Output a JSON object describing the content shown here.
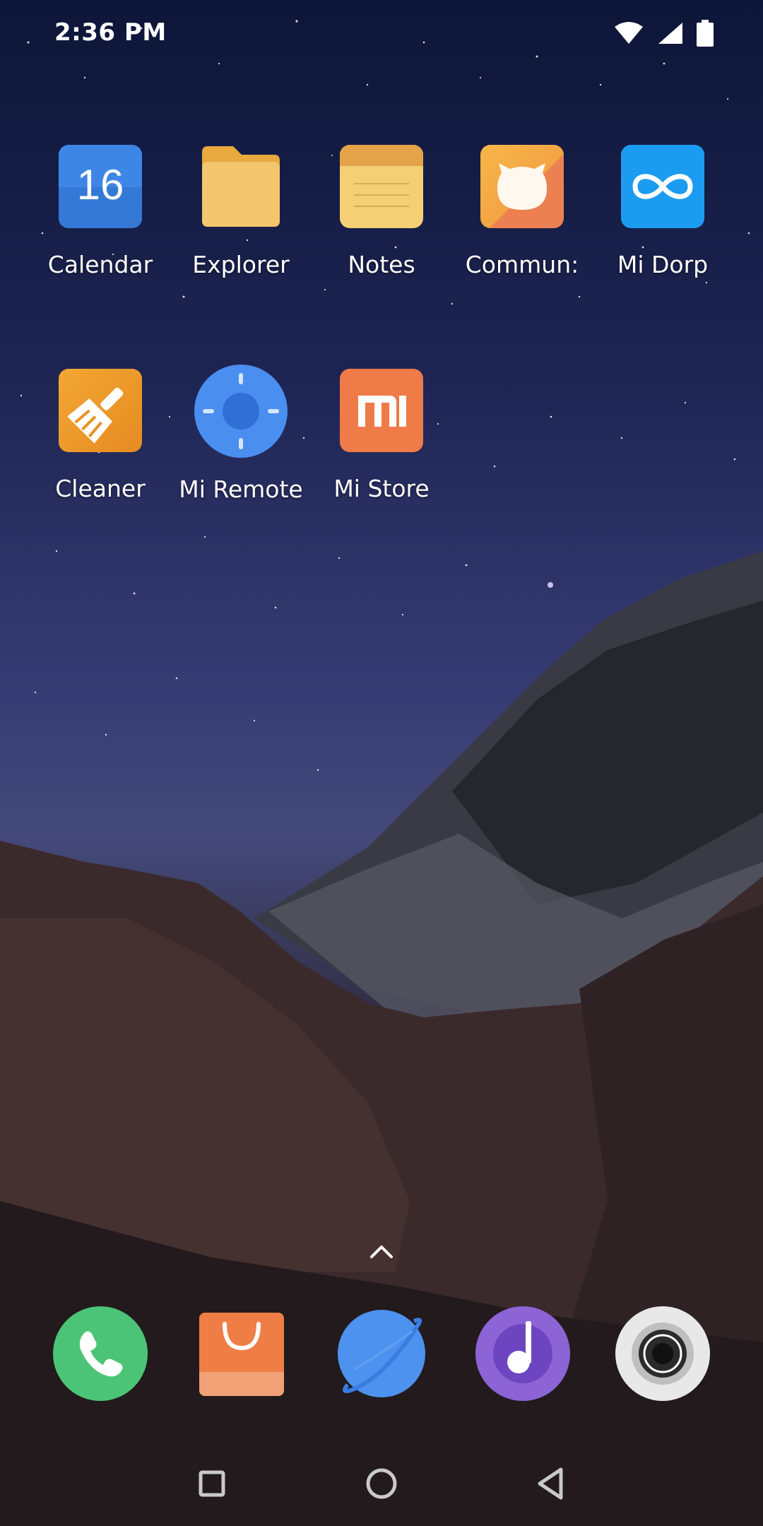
{
  "status_bar": {
    "time": "2:36 PM",
    "icons": [
      "wifi-icon",
      "cellular-signal-icon",
      "battery-icon"
    ]
  },
  "apps": [
    {
      "name": "Calendar",
      "icon": "calendar-icon",
      "badge_text": "16"
    },
    {
      "name": "Explorer",
      "icon": "folder-icon"
    },
    {
      "name": "Notes",
      "icon": "notes-icon"
    },
    {
      "name": "Commun:",
      "icon": "community-icon"
    },
    {
      "name": "Mi Dorp",
      "icon": "mi-drop-icon"
    },
    {
      "name": "Cleaner",
      "icon": "cleaner-broom-icon"
    },
    {
      "name": "Mi Remote",
      "icon": "mi-remote-icon"
    },
    {
      "name": "Mi Store",
      "icon": "mi-store-icon",
      "badge_text": "mi"
    }
  ],
  "dock": [
    "phone-icon",
    "app-store-bag-icon",
    "browser-planet-icon",
    "music-note-icon",
    "camera-icon"
  ],
  "app_drawer_hint": "chevron-up-icon",
  "navigation": [
    "recents-square-icon",
    "home-circle-icon",
    "back-triangle-icon"
  ],
  "colors": {
    "calendar": "#3d86e6",
    "folder": "#f2c46b",
    "notes": "#f4cf74",
    "community": "#f3a444",
    "mi_drop": "#1c9cf0",
    "cleaner": "#ee9a26",
    "mi_remote": "#4a8ef0",
    "mi_store": "#ee7b48",
    "phone": "#4cc477",
    "app_store": "#ee7e46",
    "browser": "#4d92ee",
    "music": "#8c64d6",
    "camera": "#e6e6e6"
  }
}
